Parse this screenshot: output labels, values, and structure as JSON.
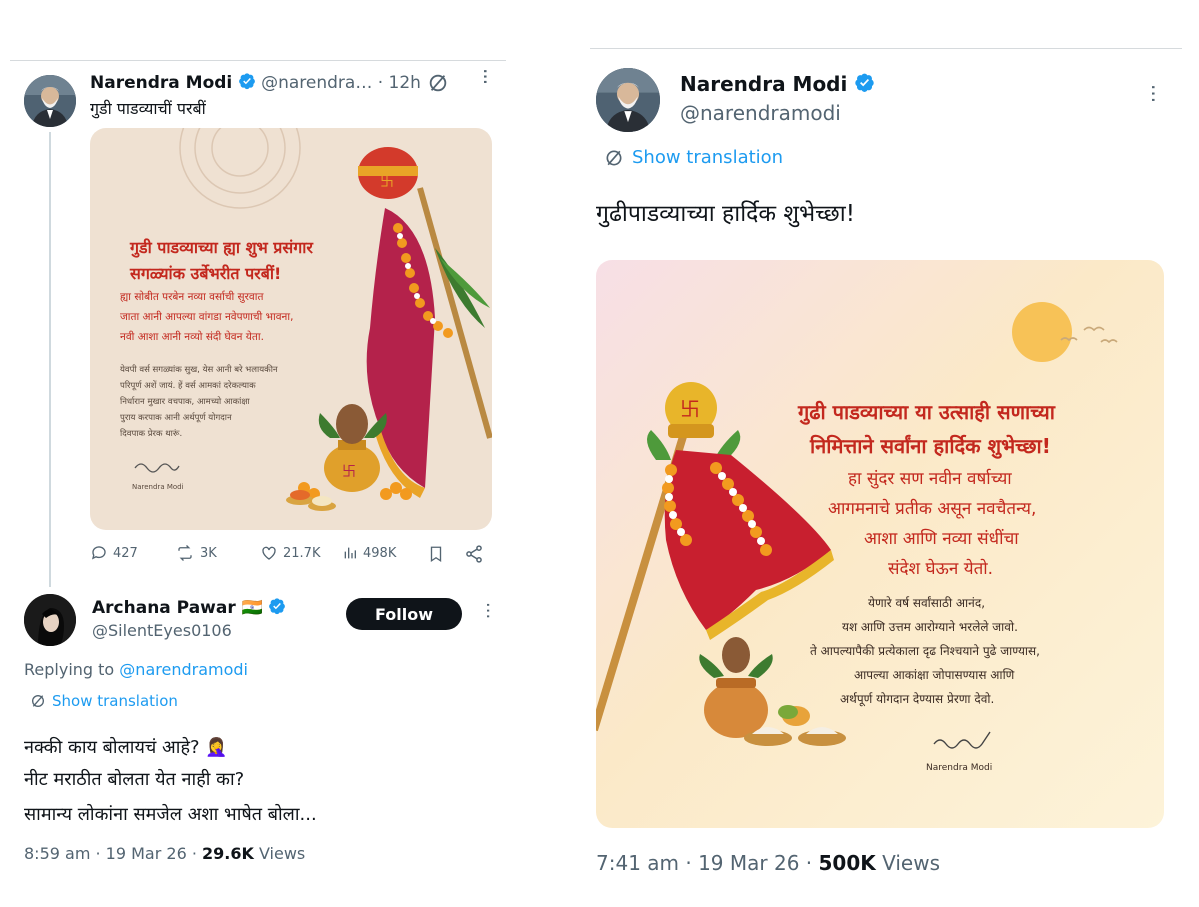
{
  "left_tweet": {
    "author_name": "Narendra Modi",
    "handle_time": "@narendra… · 12h",
    "text": "गुडी पाडव्याचीं परबीं",
    "card": {
      "headline1": "गुडी पाडव्याच्या ह्या शुभ प्रसंगार",
      "headline2": "सगळ्यांक उर्बेभरीत परबीं!",
      "para1_l1": "ह्या सोबीत परबेन नव्या वर्साची सुरवात",
      "para1_l2": "जाता आनी आपल्या वांगडा नवेपणाची भावना,",
      "para1_l3": "नवी आशा आनी नव्यो संदी घेवन येता.",
      "para2_l1": "येवपी वर्स सगळ्यांक सुख, येस आनी बरे भलायकीन",
      "para2_l2": "परिपूर्ण अशें जायं. हें वर्स आमकां दरेकल्याक",
      "para2_l3": "निर्धारान मुखार वचपाक, आमच्यो आकांक्षा",
      "para2_l4": "पुराय करपाक आनी अर्थपूर्ण योगदान",
      "para2_l5": "दिवपाक प्रेरक थारूं.",
      "signature_name": "Narendra Modi"
    },
    "actions": {
      "replies": "427",
      "reposts": "3K",
      "likes": "21.7K",
      "views": "498K"
    }
  },
  "reply": {
    "author_name": "Archana Pawar 🇮🇳",
    "handle": "@SilentEyes0106",
    "follow_label": "Follow",
    "replying_prefix": "Replying to ",
    "replying_to": "@narendramodi",
    "show_translation": "Show translation",
    "line1": "नक्की काय बोलायचं आहे? 🤦‍♀️",
    "line2": "नीट मराठीत बोलता येत नाही का?",
    "line3": "सामान्य लोकांना समजेल अशा भाषेत बोला...",
    "time_date": "8:59 am · 19 Mar 26 · ",
    "views_count": "29.6K",
    "views_label": " Views"
  },
  "right_tweet": {
    "author_name": "Narendra Modi",
    "handle": "@narendramodi",
    "show_translation": "Show translation",
    "text": "गुढीपाडव्याच्या हार्दिक शुभेच्छा!",
    "card": {
      "headline1": "गुढी पाडव्याच्या या उत्साही सणाच्या",
      "headline2": "निमित्ताने सर्वांना हार्दिक शुभेच्छा!",
      "sub1": "हा सुंदर सण नवीन वर्षाच्या",
      "sub2": "आगमनाचे प्रतीक असून नवचैतन्य,",
      "sub3": "आशा आणि नव्या संधींचा",
      "sub4": "संदेश घेऊन येतो.",
      "p1": "येणारे वर्ष सर्वांसाठी आनंद,",
      "p2": "यश आणि उत्तम आरोग्याने भरलेले जावो.",
      "p3": "ते आपल्यापैकी प्रत्येकाला दृढ निश्चयाने पुढे जाण्यास,",
      "p4": "आपल्या आकांक्षा जोपासण्यास आणि",
      "p5": "अर्थपूर्ण योगदान देण्यास प्रेरणा देवो.",
      "signature_name": "Narendra Modi"
    },
    "time_date": "7:41 am · 19 Mar 26 · ",
    "views_count": "500K",
    "views_label": " Views"
  },
  "colors": {
    "accent": "#1d9bf0",
    "text": "#0f1419",
    "muted": "#536471",
    "card_left_bg": "#efe1d2",
    "card_right_bg": "#fbe9c8",
    "headline_red": "#c3281e"
  }
}
